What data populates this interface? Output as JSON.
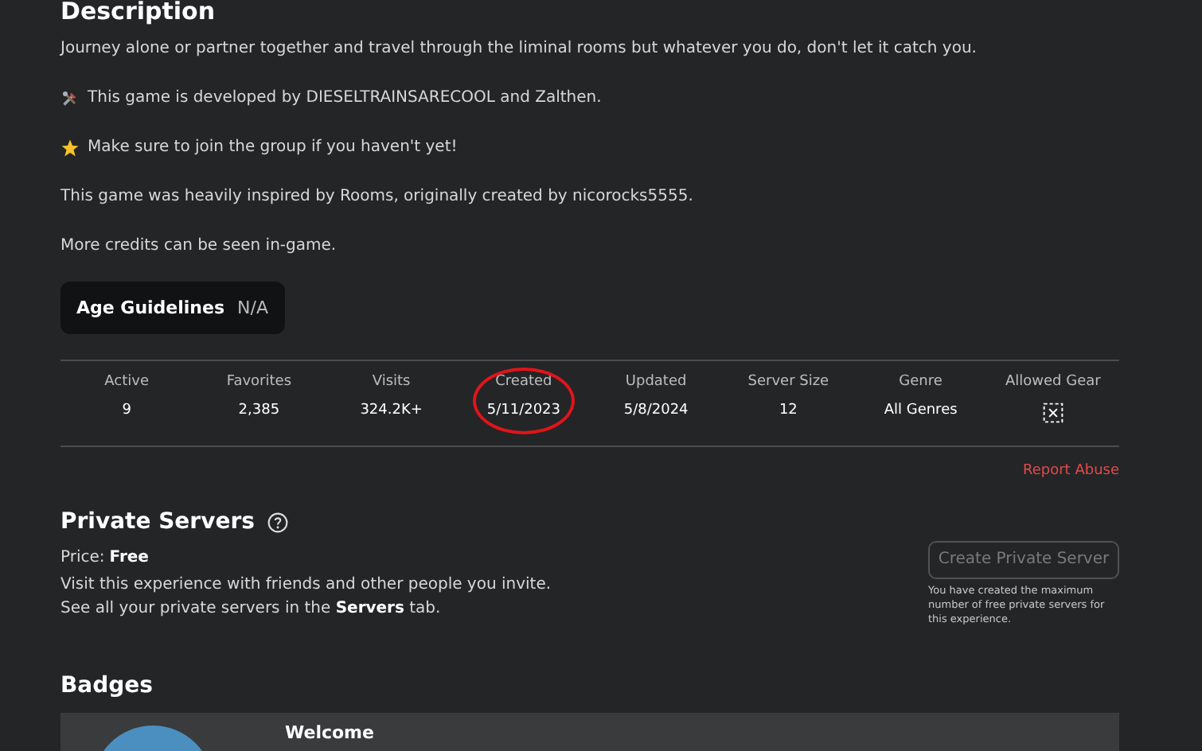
{
  "description": {
    "title": "Description",
    "paragraphs": [
      {
        "kind": "plain",
        "text": "Journey alone or partner together and travel through the liminal rooms but whatever you do, don't let it catch you."
      },
      {
        "kind": "tools",
        "text": "This game is developed by DIESELTRAINSARECOOL and Zalthen."
      },
      {
        "kind": "star",
        "text": "Make sure to join the group if you haven't yet!"
      },
      {
        "kind": "plain",
        "text": "This game was heavily inspired by Rooms, originally created by nicorocks5555."
      },
      {
        "kind": "plain",
        "text": "More credits can be seen in-game."
      }
    ],
    "age_guidelines": {
      "label": "Age Guidelines",
      "value": "N/A"
    }
  },
  "stats": [
    {
      "label": "Active",
      "kind": "text",
      "value": "9",
      "circled": false
    },
    {
      "label": "Favorites",
      "kind": "text",
      "value": "2,385",
      "circled": false
    },
    {
      "label": "Visits",
      "kind": "text",
      "value": "324.2K+",
      "circled": false
    },
    {
      "label": "Created",
      "kind": "text",
      "value": "5/11/2023",
      "circled": true,
      "color": "#e0141a"
    },
    {
      "label": "Updated",
      "kind": "text",
      "value": "5/8/2024",
      "circled": false
    },
    {
      "label": "Server Size",
      "kind": "text",
      "value": "12",
      "circled": false
    },
    {
      "label": "Genre",
      "kind": "text",
      "value": "All Genres",
      "circled": false
    },
    {
      "label": "Allowed Gear",
      "kind": "gear-none",
      "circled": false
    }
  ],
  "report_abuse": "Report Abuse",
  "private_servers": {
    "title": "Private Servers",
    "price_label": "Price:",
    "price": "Free",
    "info": "Visit this experience with friends and other people you invite.\nSee all your private servers in the **Servers** tab.",
    "button": {
      "label": "Create Private Server",
      "disabled": true
    },
    "note": "You have created the maximum number of free private servers for this experience."
  },
  "badges": {
    "title": "Badges",
    "items": [
      {
        "name": "Welcome"
      }
    ]
  }
}
